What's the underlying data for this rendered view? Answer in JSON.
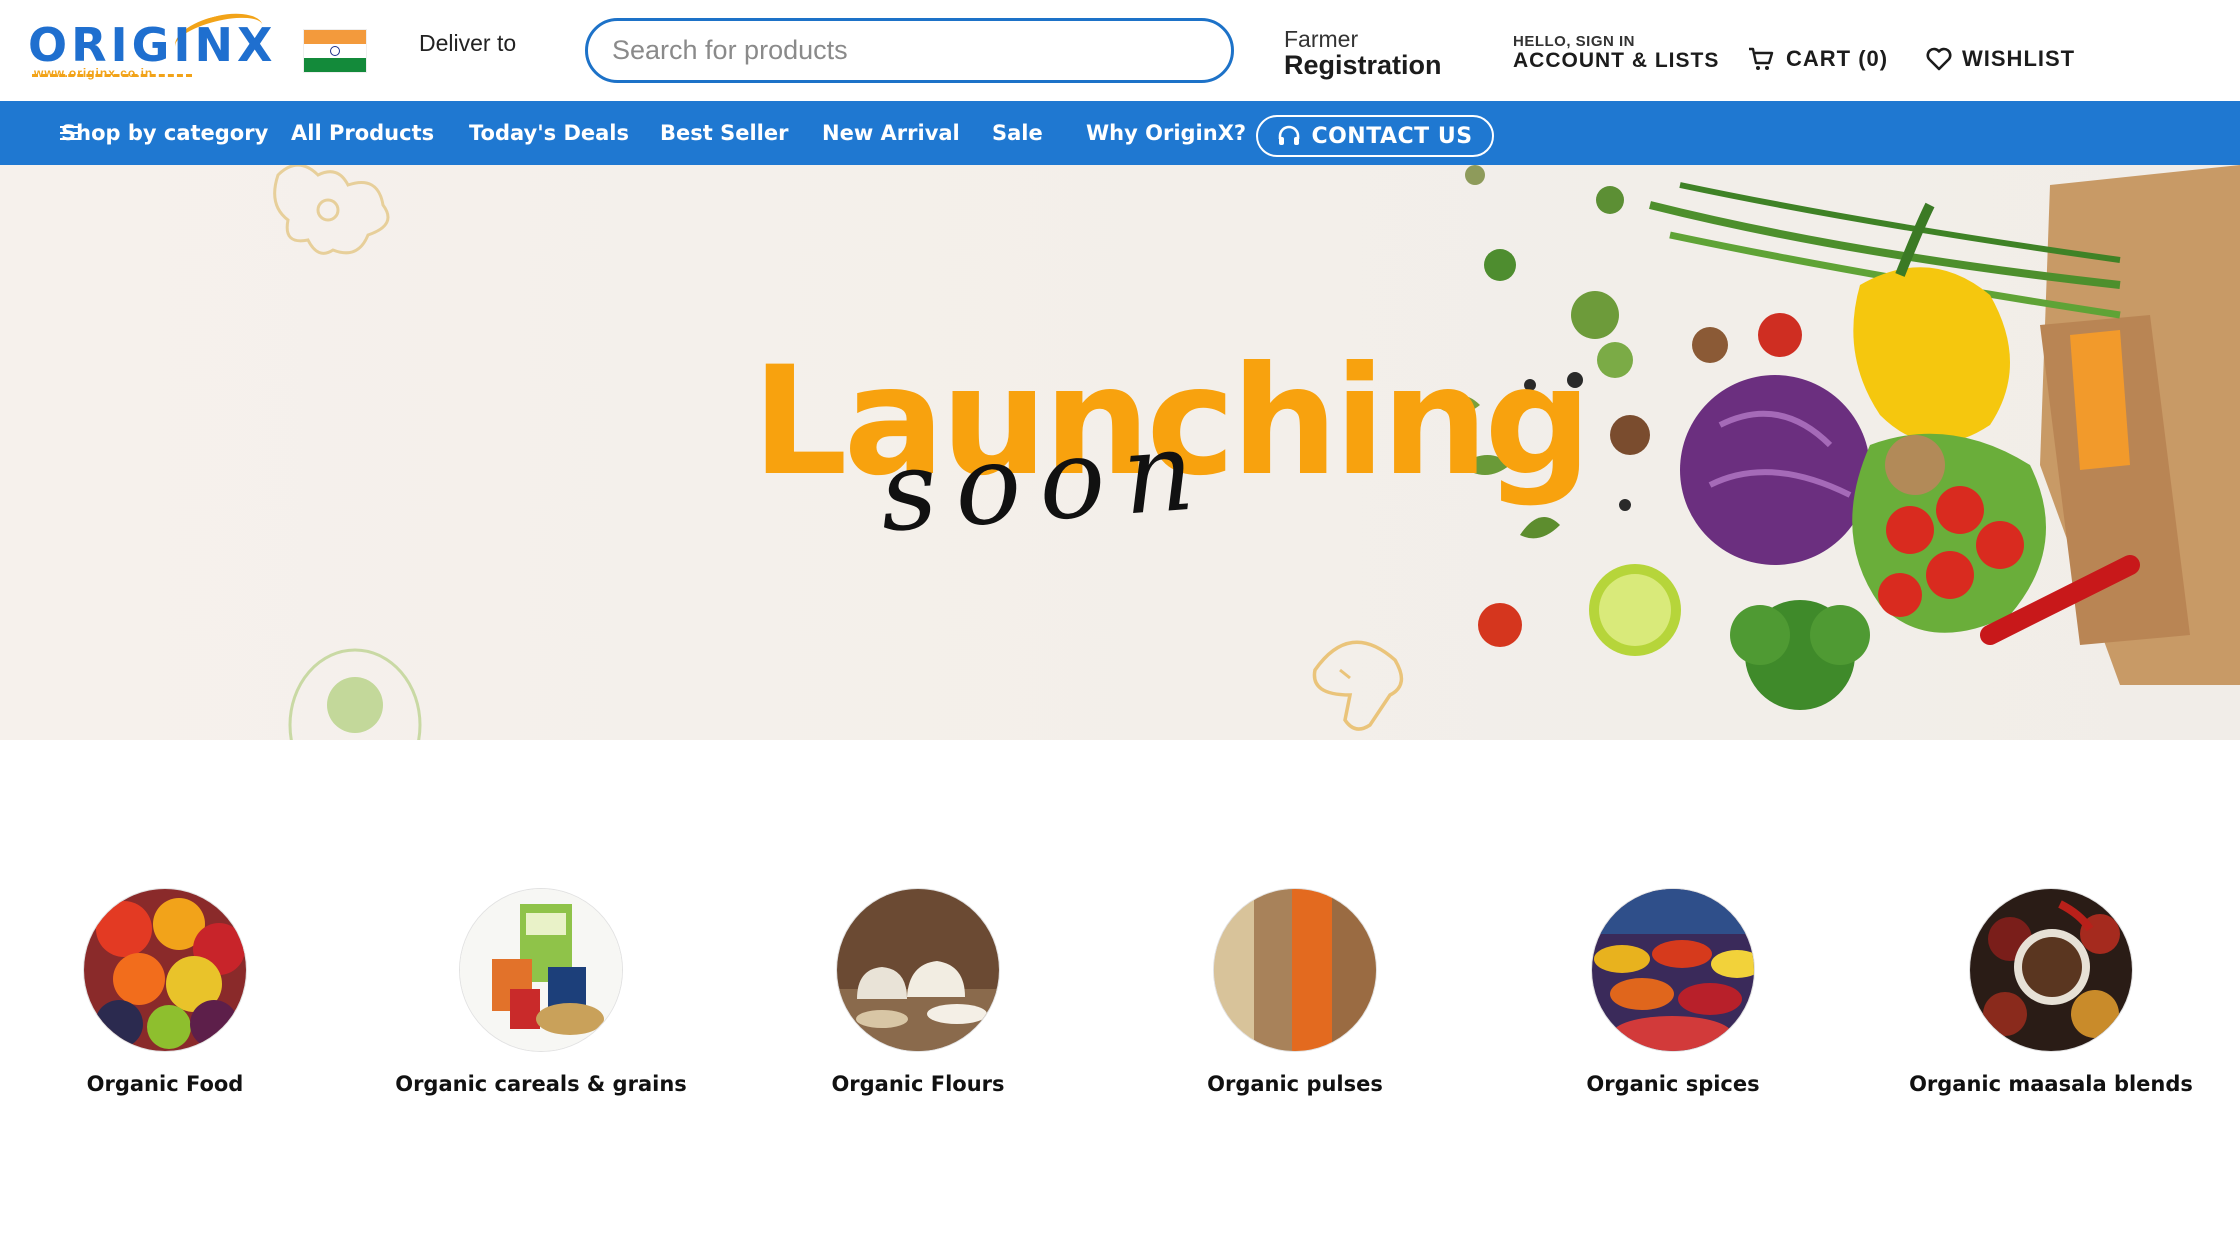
{
  "header": {
    "logo_text": "ORIGINX",
    "logo_url_text": "www.originx.co.in",
    "deliver_label": "Deliver to",
    "search_placeholder": "Search for products",
    "farmer_line1": "Farmer",
    "farmer_line2": "Registration",
    "account_line1": "HELLO, SIGN IN",
    "account_line2": "ACCOUNT & LISTS",
    "cart_label": "CART (0)",
    "wishlist_label": "WISHLIST"
  },
  "nav": {
    "items": [
      {
        "label": "Shop by category",
        "icon": "menu-icon"
      },
      {
        "label": "All Products"
      },
      {
        "label": "Today's Deals"
      },
      {
        "label": "Best Seller"
      },
      {
        "label": "New Arrival"
      },
      {
        "label": "Sale"
      },
      {
        "label": "Why OriginX?"
      }
    ],
    "contact_label": "CONTACT US",
    "contact_icon": "headset-icon"
  },
  "hero": {
    "title": "Launching",
    "script": "soon"
  },
  "categories": [
    {
      "label": "Organic Food"
    },
    {
      "label": "Organic careals & grains"
    },
    {
      "label": "Organic Flours"
    },
    {
      "label": "Organic pulses"
    },
    {
      "label": "Organic spices"
    },
    {
      "label": "Organic maasala blends"
    }
  ],
  "colors": {
    "brand_blue": "#1f78d1",
    "accent_orange": "#f8a20e",
    "search_border": "#1d72c8"
  }
}
